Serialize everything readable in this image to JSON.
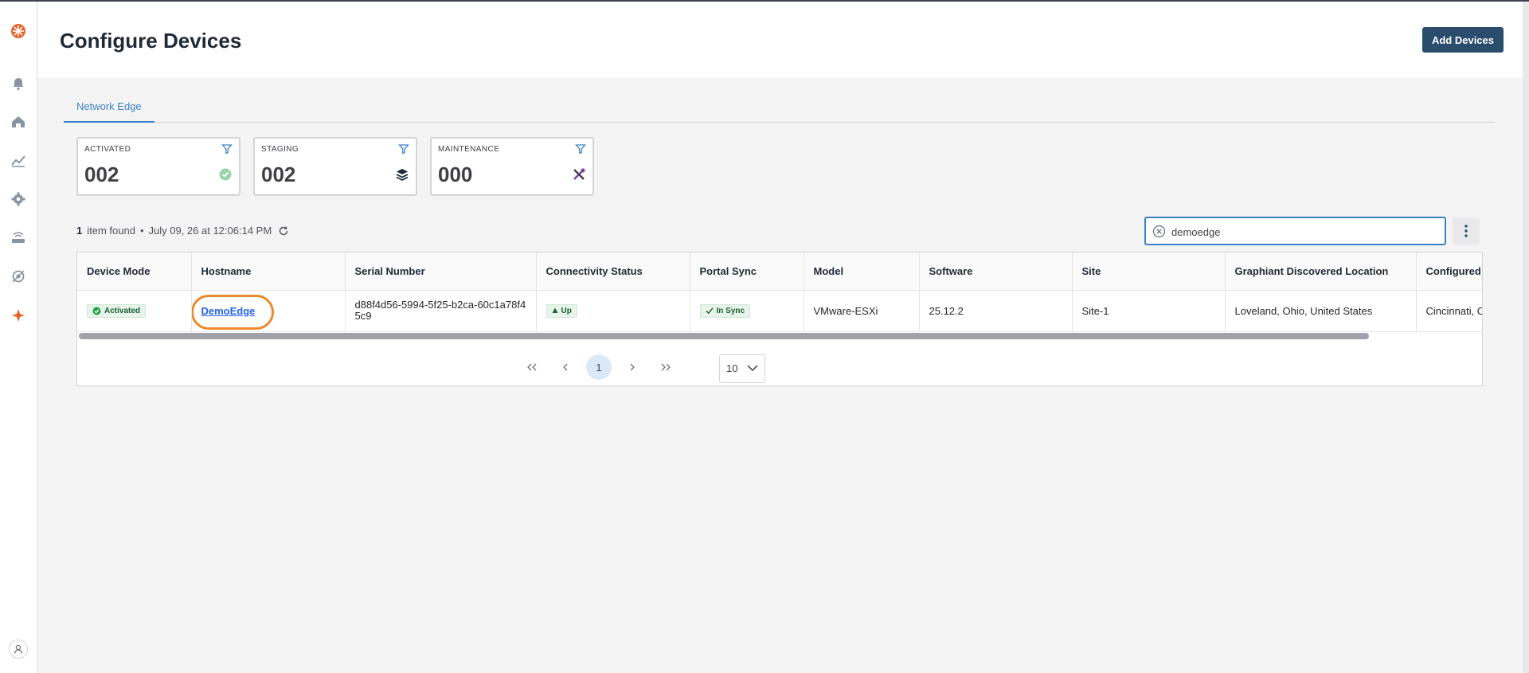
{
  "header": {
    "title": "Configure Devices",
    "add_button_label": "Add Devices"
  },
  "tabs": [
    {
      "label": "Network Edge",
      "active": true
    }
  ],
  "summary_cards": [
    {
      "label": "ACTIVATED",
      "value": "002",
      "status_icon": "check-circle-icon"
    },
    {
      "label": "STAGING",
      "value": "002",
      "status_icon": "layers-icon"
    },
    {
      "label": "MAINTENANCE",
      "value": "000",
      "status_icon": "wrench-screwdriver-icon"
    }
  ],
  "results": {
    "count": "1",
    "text": "item found",
    "separator": "•",
    "timestamp": "July 09, 26 at 12:06:14 PM"
  },
  "search": {
    "value": "demoedge"
  },
  "table": {
    "columns": [
      "Device Mode",
      "Hostname",
      "Serial Number",
      "Connectivity Status",
      "Portal Sync",
      "Model",
      "Software",
      "Site",
      "Graphiant Discovered Location",
      "Configured Location"
    ],
    "rows": [
      {
        "device_mode": "Activated",
        "hostname": "DemoEdge",
        "serial_number": "d88f4d56-5994-5f25-b2ca-60c1a78f45c9",
        "connectivity_status": "Up",
        "portal_sync": "In Sync",
        "model": "VMware-ESXi",
        "software": "25.12.2",
        "site": "Site-1",
        "discovered_location": "Loveland, Ohio, United States",
        "configured_location": "Cincinnati, Ohio, United States"
      }
    ]
  },
  "pagination": {
    "current_page": "1",
    "page_size": "10"
  },
  "colors": {
    "primary_button": "#2a4d6e",
    "accent": "#3b82c4",
    "highlight_ring": "#e98b2a",
    "success": "#22a34a",
    "brand": "#e8632b"
  }
}
